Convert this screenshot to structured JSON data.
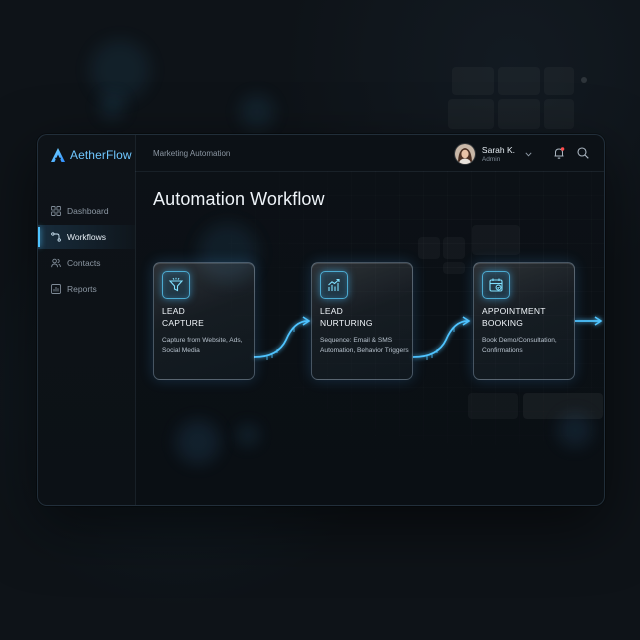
{
  "app": {
    "brand_name": "AetherFlow",
    "accent": "#4fc4ff"
  },
  "sidebar": {
    "items": [
      {
        "label": "Dashboard",
        "icon": "grid-icon",
        "active": false
      },
      {
        "label": "Workflows",
        "icon": "workflow-icon",
        "active": true
      },
      {
        "label": "Contacts",
        "icon": "users-icon",
        "active": false
      },
      {
        "label": "Reports",
        "icon": "chart-icon",
        "active": false
      }
    ]
  },
  "header": {
    "breadcrumb": "Marketing Automation",
    "user_name": "Sarah K.",
    "user_role": "Admin"
  },
  "main": {
    "title": "Automation Workflow",
    "steps": [
      {
        "title_line1": "LEAD",
        "title_line2": "CAPTURE",
        "description": "Capture from Website, Ads, Social Media",
        "icon": "funnel-icon"
      },
      {
        "title_line1": "LEAD",
        "title_line2": "NURTURING",
        "description": "Sequence: Email & SMS Automation, Behavior Triggers",
        "icon": "growth-chart-icon"
      },
      {
        "title_line1": "APPOINTMENT",
        "title_line2": "BOOKING",
        "description": "Book Demo/Consultation, Confirmations",
        "icon": "calendar-check-icon"
      }
    ]
  }
}
